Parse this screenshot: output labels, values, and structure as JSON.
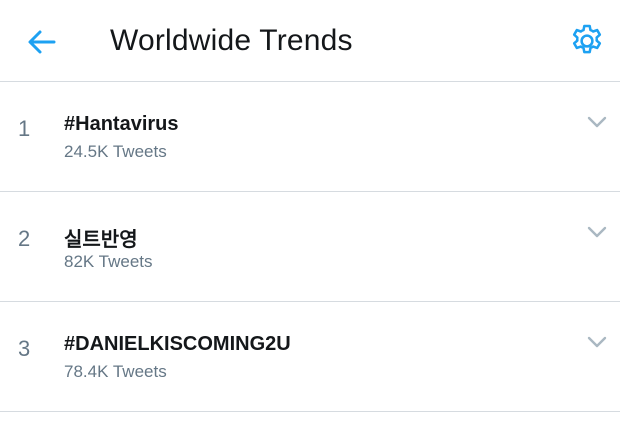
{
  "header": {
    "title": "Worldwide Trends",
    "back_icon": "arrow-left-icon",
    "settings_icon": "gear-icon"
  },
  "colors": {
    "accent": "#1da1f2",
    "text_primary": "#14171a",
    "text_secondary": "#657786",
    "divider": "#d6dbe0",
    "chevron": "#aab8c2"
  },
  "trends": [
    {
      "rank": "1",
      "name": "#Hantavirus",
      "count": "24.5K Tweets"
    },
    {
      "rank": "2",
      "name": "실트반영",
      "count": "82K Tweets"
    },
    {
      "rank": "3",
      "name": "#DANIELKISCOMING2U",
      "count": "78.4K Tweets"
    }
  ]
}
